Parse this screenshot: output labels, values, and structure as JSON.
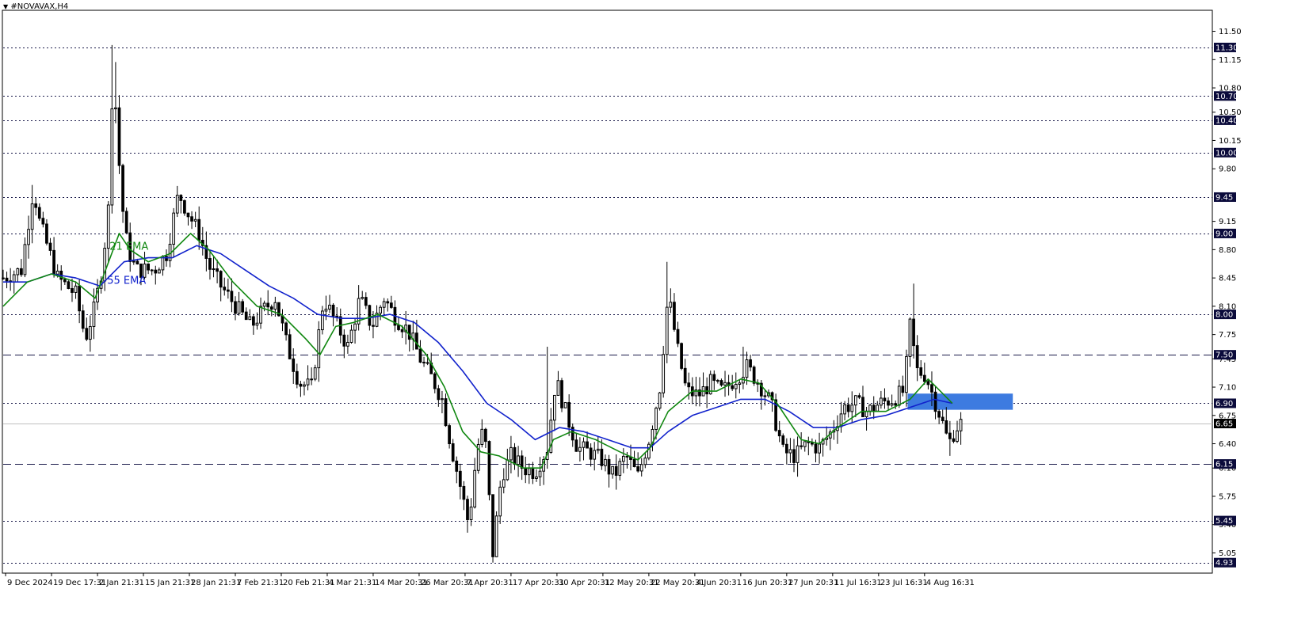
{
  "window": {
    "title": "#NOVAVAX,H4",
    "menu_icon": "triangle-down-icon"
  },
  "colors": {
    "background": "#ffffff",
    "candle": "#000000",
    "ema21": "#118811",
    "ema55": "#1122cc",
    "level_line": "#1a1a4a",
    "price_badge": "#0b0b3b",
    "current_badge": "#000000",
    "zone": "#3d7be0"
  },
  "chart_data": {
    "type": "candlestick",
    "symbol": "#NOVAVAX",
    "timeframe": "H4",
    "y_range": [
      4.8,
      11.75
    ],
    "y_ticks": [
      11.5,
      11.15,
      10.8,
      10.5,
      10.15,
      9.8,
      9.15,
      8.8,
      8.45,
      8.1,
      7.75,
      7.45,
      7.1,
      6.75,
      6.4,
      6.1,
      5.75,
      5.4,
      5.05
    ],
    "x_range": [
      0,
      100
    ],
    "x_labels": [
      {
        "pos": 0.2,
        "label": "9 Dec 2024"
      },
      {
        "pos": 4.0,
        "label": "19 Dec 17:31"
      },
      {
        "pos": 7.8,
        "label": "2 Jan 21:31"
      },
      {
        "pos": 11.6,
        "label": "15 Jan 21:31"
      },
      {
        "pos": 15.4,
        "label": "28 Jan 21:31"
      },
      {
        "pos": 19.2,
        "label": "7 Feb 21:31"
      },
      {
        "pos": 23.0,
        "label": "20 Feb 21:31"
      },
      {
        "pos": 26.8,
        "label": "4 Mar 21:31"
      },
      {
        "pos": 30.6,
        "label": "14 Mar 20:31"
      },
      {
        "pos": 34.4,
        "label": "26 Mar 20:31"
      },
      {
        "pos": 38.2,
        "label": "7 Apr 20:31"
      },
      {
        "pos": 42.0,
        "label": "17 Apr 20:31"
      },
      {
        "pos": 45.8,
        "label": "30 Apr 20:31"
      },
      {
        "pos": 49.6,
        "label": "12 May 20:31"
      },
      {
        "pos": 53.4,
        "label": "22 May 20:31"
      },
      {
        "pos": 57.2,
        "label": "4 Jun 20:31"
      },
      {
        "pos": 61.0,
        "label": "16 Jun 20:31"
      },
      {
        "pos": 64.8,
        "label": "27 Jun 20:31"
      },
      {
        "pos": 68.6,
        "label": "11 Jul 16:31"
      },
      {
        "pos": 72.4,
        "label": "23 Jul 16:31"
      },
      {
        "pos": 76.2,
        "label": "4 Aug 16:31"
      }
    ],
    "horizontal_levels": [
      {
        "price": 11.3,
        "label": "11.30",
        "style": "dotted"
      },
      {
        "price": 10.7,
        "label": "10.70",
        "style": "dotted"
      },
      {
        "price": 10.4,
        "label": "10.40",
        "style": "dotted"
      },
      {
        "price": 10.0,
        "label": "10.00",
        "style": "dotted"
      },
      {
        "price": 9.45,
        "label": "9.45",
        "style": "dotted"
      },
      {
        "price": 9.0,
        "label": "9.00",
        "style": "dotted"
      },
      {
        "price": 8.0,
        "label": "8.00",
        "style": "dotted"
      },
      {
        "price": 7.5,
        "label": "7.50",
        "style": "dashed"
      },
      {
        "price": 6.9,
        "label": "6.90",
        "style": "dotted"
      },
      {
        "price": 6.15,
        "label": "6.15",
        "style": "dashed"
      },
      {
        "price": 5.45,
        "label": "5.45",
        "style": "dotted"
      },
      {
        "price": 4.93,
        "label": "4.93",
        "style": "dotted"
      }
    ],
    "current_price": {
      "price": 6.65,
      "label": "6.65"
    },
    "zone": {
      "x_start": 74.8,
      "x_end": 83.5,
      "price_top": 7.02,
      "price_bottom": 6.82
    },
    "annotations": [
      {
        "text": "21 EMA",
        "x": 8.8,
        "price": 8.8,
        "color": "#118811"
      },
      {
        "text": "55 EMA",
        "x": 8.6,
        "price": 8.38,
        "color": "#1122cc"
      }
    ],
    "series_path": [
      {
        "t": 0,
        "p": 8.45
      },
      {
        "t": 1.5,
        "p": 8.55
      },
      {
        "t": 2.5,
        "p": 9.55
      },
      {
        "t": 3.0,
        "p": 9.15
      },
      {
        "t": 4.5,
        "p": 8.45
      },
      {
        "t": 6.0,
        "p": 8.25
      },
      {
        "t": 6.8,
        "p": 7.7
      },
      {
        "t": 7.6,
        "p": 8.1
      },
      {
        "t": 8.2,
        "p": 8.6
      },
      {
        "t": 8.7,
        "p": 9.3
      },
      {
        "t": 9.1,
        "p": 11.1
      },
      {
        "t": 9.4,
        "p": 10.3
      },
      {
        "t": 9.8,
        "p": 9.4
      },
      {
        "t": 10.3,
        "p": 8.8
      },
      {
        "t": 11.0,
        "p": 8.55
      },
      {
        "t": 12.5,
        "p": 8.55
      },
      {
        "t": 13.5,
        "p": 8.75
      },
      {
        "t": 14.5,
        "p": 9.5
      },
      {
        "t": 15.3,
        "p": 9.25
      },
      {
        "t": 16.2,
        "p": 9.0
      },
      {
        "t": 17.0,
        "p": 8.6
      },
      {
        "t": 18.0,
        "p": 8.35
      },
      {
        "t": 19.0,
        "p": 8.15
      },
      {
        "t": 20.5,
        "p": 7.85
      },
      {
        "t": 21.5,
        "p": 8.05
      },
      {
        "t": 22.5,
        "p": 8.2
      },
      {
        "t": 23.5,
        "p": 7.6
      },
      {
        "t": 24.5,
        "p": 7.15
      },
      {
        "t": 25.5,
        "p": 7.1
      },
      {
        "t": 26.5,
        "p": 8.2
      },
      {
        "t": 27.5,
        "p": 7.9
      },
      {
        "t": 28.5,
        "p": 7.6
      },
      {
        "t": 29.5,
        "p": 8.2
      },
      {
        "t": 30.5,
        "p": 7.85
      },
      {
        "t": 31.5,
        "p": 8.2
      },
      {
        "t": 32.5,
        "p": 7.95
      },
      {
        "t": 33.5,
        "p": 7.8
      },
      {
        "t": 34.5,
        "p": 7.45
      },
      {
        "t": 35.5,
        "p": 7.2
      },
      {
        "t": 36.3,
        "p": 6.95
      },
      {
        "t": 37.0,
        "p": 6.4
      },
      {
        "t": 37.7,
        "p": 5.95
      },
      {
        "t": 38.5,
        "p": 5.4
      },
      {
        "t": 39.2,
        "p": 6.35
      },
      {
        "t": 39.8,
        "p": 6.6
      },
      {
        "t": 40.5,
        "p": 5.05
      },
      {
        "t": 41.2,
        "p": 6.0
      },
      {
        "t": 42.0,
        "p": 6.25
      },
      {
        "t": 43.0,
        "p": 6.1
      },
      {
        "t": 44.0,
        "p": 6.05
      },
      {
        "t": 45.0,
        "p": 6.35
      },
      {
        "t": 45.7,
        "p": 7.2
      },
      {
        "t": 46.5,
        "p": 6.8
      },
      {
        "t": 47.5,
        "p": 6.35
      },
      {
        "t": 48.5,
        "p": 6.3
      },
      {
        "t": 49.5,
        "p": 6.2
      },
      {
        "t": 50.5,
        "p": 6.0
      },
      {
        "t": 51.5,
        "p": 6.25
      },
      {
        "t": 52.5,
        "p": 6.0
      },
      {
        "t": 53.5,
        "p": 6.5
      },
      {
        "t": 54.3,
        "p": 7.1
      },
      {
        "t": 55.0,
        "p": 8.25
      },
      {
        "t": 55.8,
        "p": 7.55
      },
      {
        "t": 56.5,
        "p": 7.05
      },
      {
        "t": 57.5,
        "p": 7.0
      },
      {
        "t": 58.5,
        "p": 7.15
      },
      {
        "t": 59.5,
        "p": 7.05
      },
      {
        "t": 60.5,
        "p": 7.2
      },
      {
        "t": 61.5,
        "p": 7.35
      },
      {
        "t": 62.5,
        "p": 7.15
      },
      {
        "t": 63.5,
        "p": 6.9
      },
      {
        "t": 64.5,
        "p": 6.3
      },
      {
        "t": 65.5,
        "p": 6.25
      },
      {
        "t": 66.5,
        "p": 6.4
      },
      {
        "t": 67.5,
        "p": 6.35
      },
      {
        "t": 68.5,
        "p": 6.55
      },
      {
        "t": 69.5,
        "p": 6.85
      },
      {
        "t": 70.5,
        "p": 6.9
      },
      {
        "t": 71.5,
        "p": 6.8
      },
      {
        "t": 72.5,
        "p": 6.9
      },
      {
        "t": 73.5,
        "p": 6.95
      },
      {
        "t": 74.5,
        "p": 7.05
      },
      {
        "t": 75.0,
        "p": 7.85
      },
      {
        "t": 75.6,
        "p": 7.3
      },
      {
        "t": 76.3,
        "p": 7.25
      },
      {
        "t": 77.0,
        "p": 6.95
      },
      {
        "t": 77.6,
        "p": 6.7
      },
      {
        "t": 78.2,
        "p": 6.4
      },
      {
        "t": 78.8,
        "p": 6.6
      },
      {
        "t": 79.2,
        "p": 6.65
      }
    ],
    "ema21_points": [
      {
        "t": 0,
        "p": 8.1
      },
      {
        "t": 2,
        "p": 8.4
      },
      {
        "t": 4,
        "p": 8.5
      },
      {
        "t": 6,
        "p": 8.4
      },
      {
        "t": 7.6,
        "p": 8.2
      },
      {
        "t": 8.6,
        "p": 8.6
      },
      {
        "t": 9.6,
        "p": 9.0
      },
      {
        "t": 10.5,
        "p": 8.8
      },
      {
        "t": 12,
        "p": 8.65
      },
      {
        "t": 13.8,
        "p": 8.75
      },
      {
        "t": 15.5,
        "p": 9.0
      },
      {
        "t": 17,
        "p": 8.8
      },
      {
        "t": 19,
        "p": 8.4
      },
      {
        "t": 21,
        "p": 8.1
      },
      {
        "t": 23,
        "p": 8.0
      },
      {
        "t": 25,
        "p": 7.7
      },
      {
        "t": 26.2,
        "p": 7.5
      },
      {
        "t": 27.5,
        "p": 7.85
      },
      {
        "t": 29,
        "p": 7.9
      },
      {
        "t": 31,
        "p": 8.0
      },
      {
        "t": 33,
        "p": 7.85
      },
      {
        "t": 35,
        "p": 7.5
      },
      {
        "t": 36.5,
        "p": 7.1
      },
      {
        "t": 38,
        "p": 6.55
      },
      {
        "t": 39.5,
        "p": 6.3
      },
      {
        "t": 41,
        "p": 6.25
      },
      {
        "t": 43,
        "p": 6.1
      },
      {
        "t": 44.5,
        "p": 6.1
      },
      {
        "t": 45.5,
        "p": 6.45
      },
      {
        "t": 47,
        "p": 6.55
      },
      {
        "t": 49,
        "p": 6.45
      },
      {
        "t": 51,
        "p": 6.3
      },
      {
        "t": 52.5,
        "p": 6.2
      },
      {
        "t": 53.5,
        "p": 6.35
      },
      {
        "t": 55,
        "p": 6.8
      },
      {
        "t": 57,
        "p": 7.05
      },
      {
        "t": 59,
        "p": 7.05
      },
      {
        "t": 61,
        "p": 7.2
      },
      {
        "t": 62.5,
        "p": 7.15
      },
      {
        "t": 64,
        "p": 6.9
      },
      {
        "t": 66,
        "p": 6.45
      },
      {
        "t": 67.5,
        "p": 6.4
      },
      {
        "t": 69,
        "p": 6.6
      },
      {
        "t": 71,
        "p": 6.8
      },
      {
        "t": 73,
        "p": 6.8
      },
      {
        "t": 75,
        "p": 6.95
      },
      {
        "t": 76.5,
        "p": 7.2
      },
      {
        "t": 77.5,
        "p": 7.05
      },
      {
        "t": 78.5,
        "p": 6.9
      }
    ],
    "ema55_points": [
      {
        "t": 0,
        "p": 8.4
      },
      {
        "t": 2,
        "p": 8.4
      },
      {
        "t": 4,
        "p": 8.5
      },
      {
        "t": 6,
        "p": 8.45
      },
      {
        "t": 8,
        "p": 8.35
      },
      {
        "t": 10,
        "p": 8.65
      },
      {
        "t": 12,
        "p": 8.7
      },
      {
        "t": 14,
        "p": 8.7
      },
      {
        "t": 16,
        "p": 8.85
      },
      {
        "t": 18,
        "p": 8.75
      },
      {
        "t": 20,
        "p": 8.55
      },
      {
        "t": 22,
        "p": 8.35
      },
      {
        "t": 24,
        "p": 8.2
      },
      {
        "t": 26,
        "p": 8.0
      },
      {
        "t": 28,
        "p": 7.95
      },
      {
        "t": 30,
        "p": 7.95
      },
      {
        "t": 32,
        "p": 8.0
      },
      {
        "t": 34,
        "p": 7.9
      },
      {
        "t": 36,
        "p": 7.65
      },
      {
        "t": 38,
        "p": 7.3
      },
      {
        "t": 40,
        "p": 6.9
      },
      {
        "t": 42,
        "p": 6.7
      },
      {
        "t": 44,
        "p": 6.45
      },
      {
        "t": 46,
        "p": 6.6
      },
      {
        "t": 48,
        "p": 6.55
      },
      {
        "t": 50,
        "p": 6.45
      },
      {
        "t": 52,
        "p": 6.35
      },
      {
        "t": 53.5,
        "p": 6.35
      },
      {
        "t": 55,
        "p": 6.55
      },
      {
        "t": 57,
        "p": 6.75
      },
      {
        "t": 59,
        "p": 6.85
      },
      {
        "t": 61,
        "p": 6.95
      },
      {
        "t": 63,
        "p": 6.95
      },
      {
        "t": 65,
        "p": 6.8
      },
      {
        "t": 67,
        "p": 6.6
      },
      {
        "t": 69,
        "p": 6.6
      },
      {
        "t": 71,
        "p": 6.7
      },
      {
        "t": 73,
        "p": 6.75
      },
      {
        "t": 75,
        "p": 6.85
      },
      {
        "t": 77,
        "p": 6.95
      },
      {
        "t": 78.5,
        "p": 6.9
      }
    ]
  }
}
